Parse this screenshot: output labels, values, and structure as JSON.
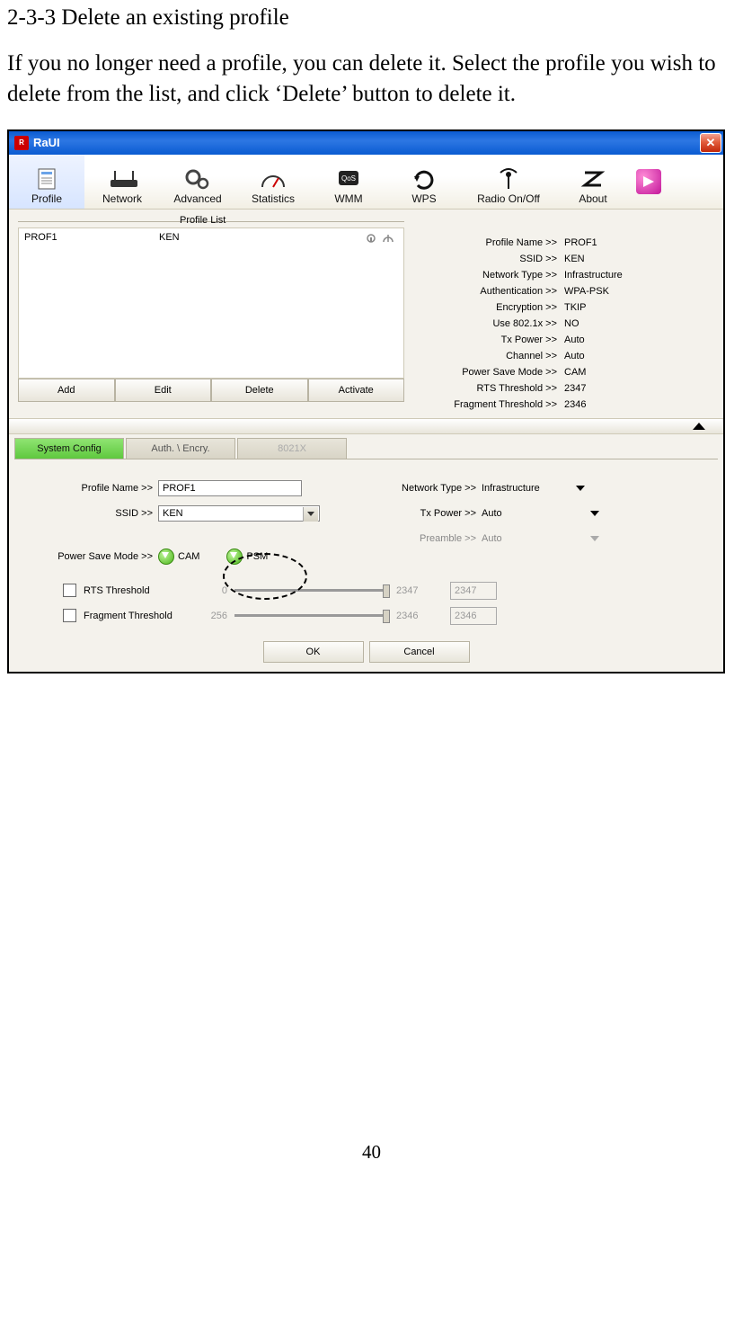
{
  "doc": {
    "heading": "2-3-3 Delete an existing profile",
    "paragraph": "If you no longer need a profile, you can delete it. Select the profile you wish to delete from the list, and click ‘Delete’ button to delete it.",
    "page_number": "40"
  },
  "window": {
    "title": "RaUI",
    "close": "✕"
  },
  "toolbar": {
    "profile": "Profile",
    "network": "Network",
    "advanced": "Advanced",
    "statistics": "Statistics",
    "wmm": "WMM",
    "wps": "WPS",
    "radio": "Radio On/Off",
    "about": "About"
  },
  "profile_list": {
    "title": "Profile List",
    "rows": [
      {
        "name": "PROF1",
        "ssid": "KEN"
      }
    ],
    "buttons": {
      "add": "Add",
      "edit": "Edit",
      "delete": "Delete",
      "activate": "Activate"
    }
  },
  "details": {
    "profile_name_k": "Profile Name >>",
    "profile_name_v": "PROF1",
    "ssid_k": "SSID >>",
    "ssid_v": "KEN",
    "nettype_k": "Network Type >>",
    "nettype_v": "Infrastructure",
    "auth_k": "Authentication >>",
    "auth_v": "WPA-PSK",
    "enc_k": "Encryption >>",
    "enc_v": "TKIP",
    "dot1x_k": "Use 802.1x >>",
    "dot1x_v": "NO",
    "txp_k": "Tx Power >>",
    "txp_v": "Auto",
    "chan_k": "Channel >>",
    "chan_v": "Auto",
    "psm_k": "Power Save Mode >>",
    "psm_v": "CAM",
    "rts_k": "RTS Threshold >>",
    "rts_v": "2347",
    "frag_k": "Fragment Threshold >>",
    "frag_v": "2346"
  },
  "tabs": {
    "system_config": "System Config",
    "auth_encry": "Auth. \\ Encry.",
    "dot1x": "8021X"
  },
  "config": {
    "profile_name_label": "Profile Name >>",
    "profile_name_value": "PROF1",
    "ssid_label": "SSID >>",
    "ssid_value": "KEN",
    "psm_label": "Power Save Mode >>",
    "cam": "CAM",
    "psm": "PSM",
    "nettype_label": "Network Type >>",
    "nettype_value": "Infrastructure",
    "txp_label": "Tx Power >>",
    "txp_value": "Auto",
    "preamble_label": "Preamble >>",
    "preamble_value": "Auto",
    "rts_label": "RTS Threshold",
    "rts_min": "0",
    "rts_max": "2347",
    "rts_val": "2347",
    "frag_label": "Fragment Threshold",
    "frag_min": "256",
    "frag_max": "2346",
    "frag_val": "2346",
    "ok": "OK",
    "cancel": "Cancel"
  }
}
